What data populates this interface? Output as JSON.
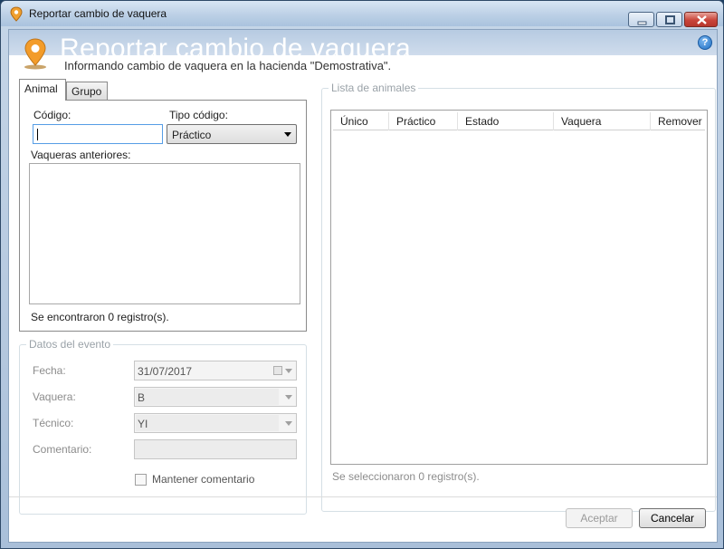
{
  "window": {
    "title": "Reportar cambio de vaquera",
    "icon": "location-pin-icon"
  },
  "banner": {
    "title": "Reportar cambio de vaquera",
    "subtitle": "Informando cambio de vaquera en la hacienda \"Demostrativa\".",
    "help": "?"
  },
  "tabs": [
    {
      "label": "Animal",
      "selected": true
    },
    {
      "label": "Grupo",
      "selected": false
    }
  ],
  "animal_tab": {
    "code_label": "Código:",
    "code_value": "",
    "code_type_label": "Tipo código:",
    "code_type_value": "Práctico",
    "previous_label": "Vaqueras anteriores:",
    "records_text": "Se encontraron 0 registro(s)."
  },
  "event": {
    "legend": "Datos del evento",
    "date_label": "Fecha:",
    "date_value": "31/07/2017",
    "vaquera_label": "Vaquera:",
    "vaquera_value": "B",
    "tecnico_label": "Técnico:",
    "tecnico_value": "YI",
    "comment_label": "Comentario:",
    "comment_value": "",
    "keep_comment_label": "Mantener comentario",
    "keep_comment_checked": false
  },
  "animal_list": {
    "legend": "Lista de animales",
    "columns": [
      "Único",
      "Práctico",
      "Estado",
      "Vaquera",
      "Remover"
    ],
    "rows": [],
    "selected_text": "Se seleccionaron 0 registro(s)."
  },
  "footer": {
    "accept_label": "Aceptar",
    "cancel_label": "Cancelar"
  },
  "colors": {
    "accent": "#569de5",
    "banner": "#b7cbe2",
    "pin": "#f0a030"
  }
}
